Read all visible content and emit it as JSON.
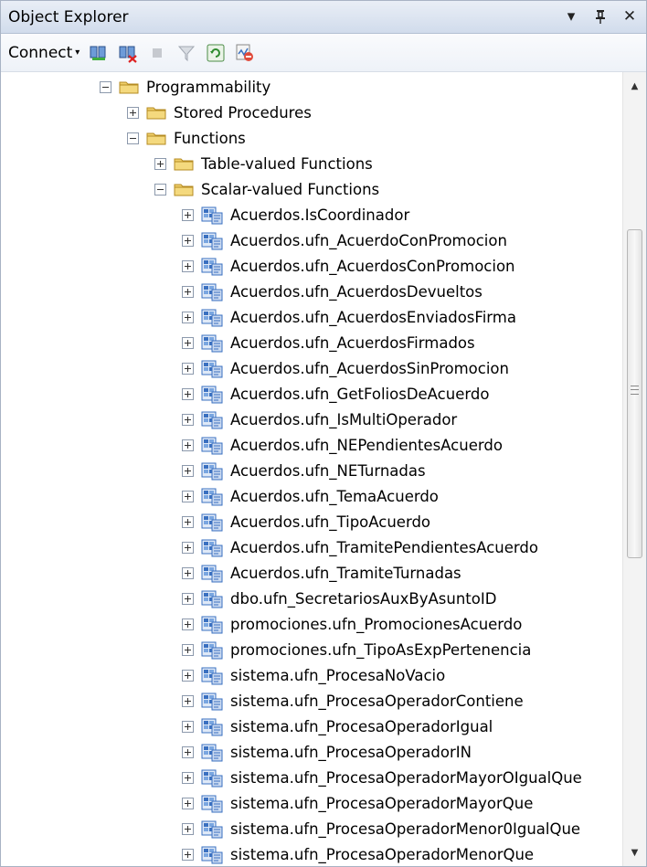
{
  "window": {
    "title": "Object Explorer"
  },
  "title_controls": {
    "dropdown": "▾",
    "pin": "ꟸ",
    "close": "✕"
  },
  "toolbar": {
    "connect_label": "Connect",
    "caret": "▾"
  },
  "tree": {
    "programmability": "Programmability",
    "stored_procedures": "Stored Procedures",
    "functions": "Functions",
    "table_valued": "Table-valued Functions",
    "scalar_valued": "Scalar-valued Functions",
    "items": [
      "Acuerdos.IsCoordinador",
      "Acuerdos.ufn_AcuerdoConPromocion",
      "Acuerdos.ufn_AcuerdosConPromocion",
      "Acuerdos.ufn_AcuerdosDevueltos",
      "Acuerdos.ufn_AcuerdosEnviadosFirma",
      "Acuerdos.ufn_AcuerdosFirmados",
      "Acuerdos.ufn_AcuerdosSinPromocion",
      "Acuerdos.ufn_GetFoliosDeAcuerdo",
      "Acuerdos.ufn_IsMultiOperador",
      "Acuerdos.ufn_NEPendientesAcuerdo",
      "Acuerdos.ufn_NETurnadas",
      "Acuerdos.ufn_TemaAcuerdo",
      "Acuerdos.ufn_TipoAcuerdo",
      "Acuerdos.ufn_TramitePendientesAcuerdo",
      "Acuerdos.ufn_TramiteTurnadas",
      "dbo.ufn_SecretariosAuxByAsuntoID",
      "promociones.ufn_PromocionesAcuerdo",
      "promociones.ufn_TipoAsExpPertenencia",
      "sistema.ufn_ProcesaNoVacio",
      "sistema.ufn_ProcesaOperadorContiene",
      "sistema.ufn_ProcesaOperadorIgual",
      "sistema.ufn_ProcesaOperadorIN",
      "sistema.ufn_ProcesaOperadorMayorOIgualQue",
      "sistema.ufn_ProcesaOperadorMayorQue",
      "sistema.ufn_ProcesaOperadorMenor0IgualQue",
      "sistema.ufn_ProcesaOperadorMenorQue"
    ]
  },
  "scrollbar": {
    "up": "▲",
    "down": "▼"
  },
  "colors": {
    "folder": "#e8c15a",
    "titlebar": "#d1dcec",
    "fn_icon": "#3a70c0"
  }
}
